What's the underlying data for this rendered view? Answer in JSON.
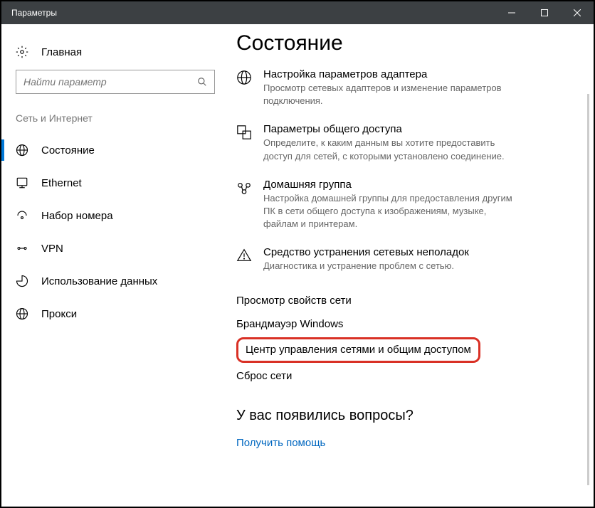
{
  "window": {
    "title": "Параметры"
  },
  "sidebar": {
    "home": "Главная",
    "search_placeholder": "Найти параметр",
    "category": "Сеть и Интернет",
    "items": [
      {
        "label": "Состояние",
        "active": true
      },
      {
        "label": "Ethernet"
      },
      {
        "label": "Набор номера"
      },
      {
        "label": "VPN"
      },
      {
        "label": "Использование данных"
      },
      {
        "label": "Прокси"
      }
    ]
  },
  "main": {
    "title": "Состояние",
    "sections": [
      {
        "title": "Настройка параметров адаптера",
        "desc": "Просмотр сетевых адаптеров и изменение параметров подключения."
      },
      {
        "title": "Параметры общего доступа",
        "desc": "Определите, к каким данным вы хотите предоставить доступ для сетей, с которыми установлено соединение."
      },
      {
        "title": "Домашняя группа",
        "desc": "Настройка домашней группы для предоставления другим ПК в сети общего доступа к изображениям, музыке, файлам и принтерам."
      },
      {
        "title": "Средство устранения сетевых неполадок",
        "desc": "Диагностика и устранение проблем с сетью."
      }
    ],
    "links": [
      "Просмотр свойств сети",
      "Брандмауэр Windows",
      "Центр управления сетями и общим доступом",
      "Сброс сети"
    ],
    "questions_title": "У вас появились вопросы?",
    "help_link": "Получить помощь"
  }
}
